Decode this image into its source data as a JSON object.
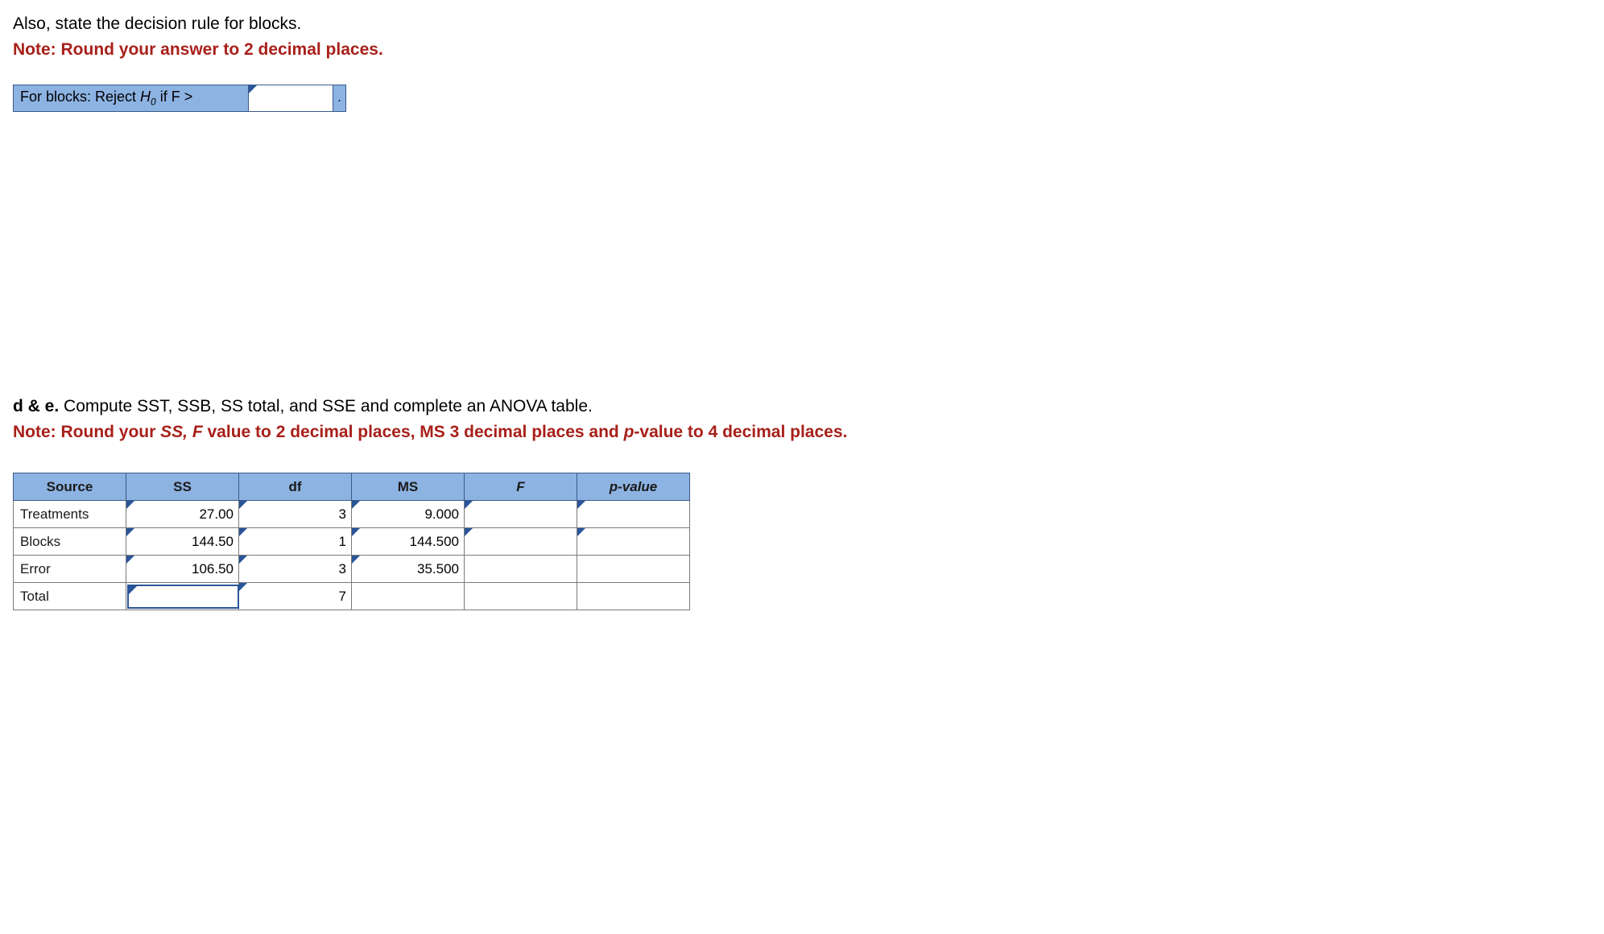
{
  "section1": {
    "instruction": "Also, state the decision rule for blocks.",
    "note": "Note: Round your answer to 2 decimal places.",
    "label": "For blocks: Reject H0 if F >",
    "label_prefix": "For blocks: Reject ",
    "label_h": "H",
    "label_sub": "0",
    "label_suffix": " if F >",
    "input_value": "",
    "dot": "."
  },
  "section2": {
    "prefix": "d & e.",
    "instruction": " Compute SST, SSB, SS total, and SSE and complete an ANOVA table.",
    "note_prefix": "Note: Round your ",
    "note_ssf_italic": "SS, F",
    "note_mid": " value to 2 decimal places, MS 3 decimal places and ",
    "note_p_italic": "p",
    "note_suffix": "-value to 4 decimal places."
  },
  "anova": {
    "headers": {
      "source": "Source",
      "ss": "SS",
      "df": "df",
      "ms": "MS",
      "f": "F",
      "p": "p-value"
    },
    "rows": [
      {
        "source": "Treatments",
        "ss": "27.00",
        "df": "3",
        "ms": "9.000",
        "f": "",
        "p": ""
      },
      {
        "source": "Blocks",
        "ss": "144.50",
        "df": "1",
        "ms": "144.500",
        "f": "",
        "p": ""
      },
      {
        "source": "Error",
        "ss": "106.50",
        "df": "3",
        "ms": "35.500",
        "f": "",
        "p": ""
      },
      {
        "source": "Total",
        "ss": "",
        "df": "7",
        "ms": "",
        "f": "",
        "p": ""
      }
    ]
  }
}
